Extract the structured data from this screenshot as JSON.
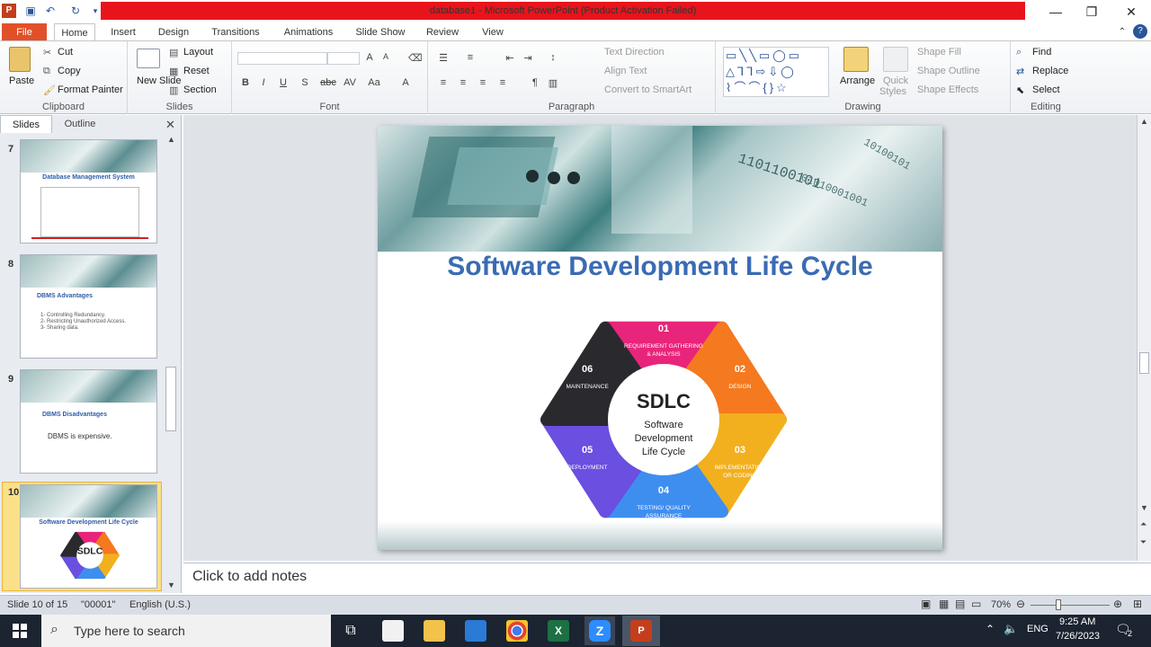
{
  "window": {
    "title": "database1 - Microsoft PowerPoint (Product Activation Failed)",
    "minimize": "—",
    "maximize": "❐",
    "close": "✕"
  },
  "tabs": [
    "File",
    "Home",
    "Insert",
    "Design",
    "Transitions",
    "Animations",
    "Slide Show",
    "Review",
    "View"
  ],
  "ribbon": {
    "clipboard": {
      "label": "Clipboard",
      "paste": "Paste",
      "cut": "Cut",
      "copy": "Copy",
      "format_painter": "Format Painter"
    },
    "slides": {
      "label": "Slides",
      "new_slide": "New Slide",
      "new_slide_line2": "Slide",
      "layout": "Layout",
      "reset": "Reset",
      "section": "Section"
    },
    "font": {
      "label": "Font"
    },
    "paragraph": {
      "label": "Paragraph",
      "text_direction": "Text Direction",
      "align_text": "Align Text",
      "convert_smartart": "Convert to SmartArt"
    },
    "drawing": {
      "label": "Drawing",
      "arrange": "Arrange",
      "quick_styles": "Quick",
      "quick_styles_line2": "Styles",
      "shape_fill": "Shape Fill",
      "shape_outline": "Shape Outline",
      "shape_effects": "Shape Effects"
    },
    "editing": {
      "label": "Editing",
      "find": "Find",
      "replace": "Replace",
      "select": "Select"
    }
  },
  "panel": {
    "tab_slides": "Slides",
    "tab_outline": "Outline",
    "thumbnails": [
      {
        "num": "7",
        "title": "Database  Management  System"
      },
      {
        "num": "8",
        "title": "DBMS Advantages",
        "body": [
          "1- Controlling Redundancy.",
          "2- Restricting Unauthorized Access.",
          "3- Sharing data."
        ]
      },
      {
        "num": "9",
        "title": "DBMS Disadvantages",
        "body": [
          "DBMS is expensive."
        ]
      },
      {
        "num": "10",
        "title": "Software  Development Life Cycle"
      }
    ]
  },
  "slide": {
    "title": "Software Development Life Cycle",
    "center_title": "SDLC",
    "center_sub": [
      "Software",
      "Development",
      "Life Cycle"
    ],
    "segments": [
      {
        "num": "01",
        "label": [
          "REQUIREMENT GATHERING",
          "& ANALYSIS"
        ],
        "color": "#e8257a"
      },
      {
        "num": "02",
        "label": [
          "DESIGN"
        ],
        "color": "#f4791f"
      },
      {
        "num": "03",
        "label": [
          "IMPLEMENTATION",
          "OR CODING"
        ],
        "color": "#f2b01e"
      },
      {
        "num": "04",
        "label": [
          "TESTING/ QUALITY",
          "ASSURANCE"
        ],
        "color": "#3e8ef0"
      },
      {
        "num": "05",
        "label": [
          "DEPLOYMENT"
        ],
        "color": "#6a4fe0"
      },
      {
        "num": "06",
        "label": [
          "MAINTENANCE"
        ],
        "color": "#2a2a2e"
      }
    ]
  },
  "notes_placeholder": "Click to add notes",
  "status": {
    "slide": "Slide 10 of 15",
    "theme": "\"00001\"",
    "language": "English (U.S.)",
    "zoom": "70%"
  },
  "taskbar": {
    "search_placeholder": "Type here to search",
    "lang": "ENG",
    "time": "9:25 AM",
    "date": "7/26/2023",
    "notif": "2"
  }
}
